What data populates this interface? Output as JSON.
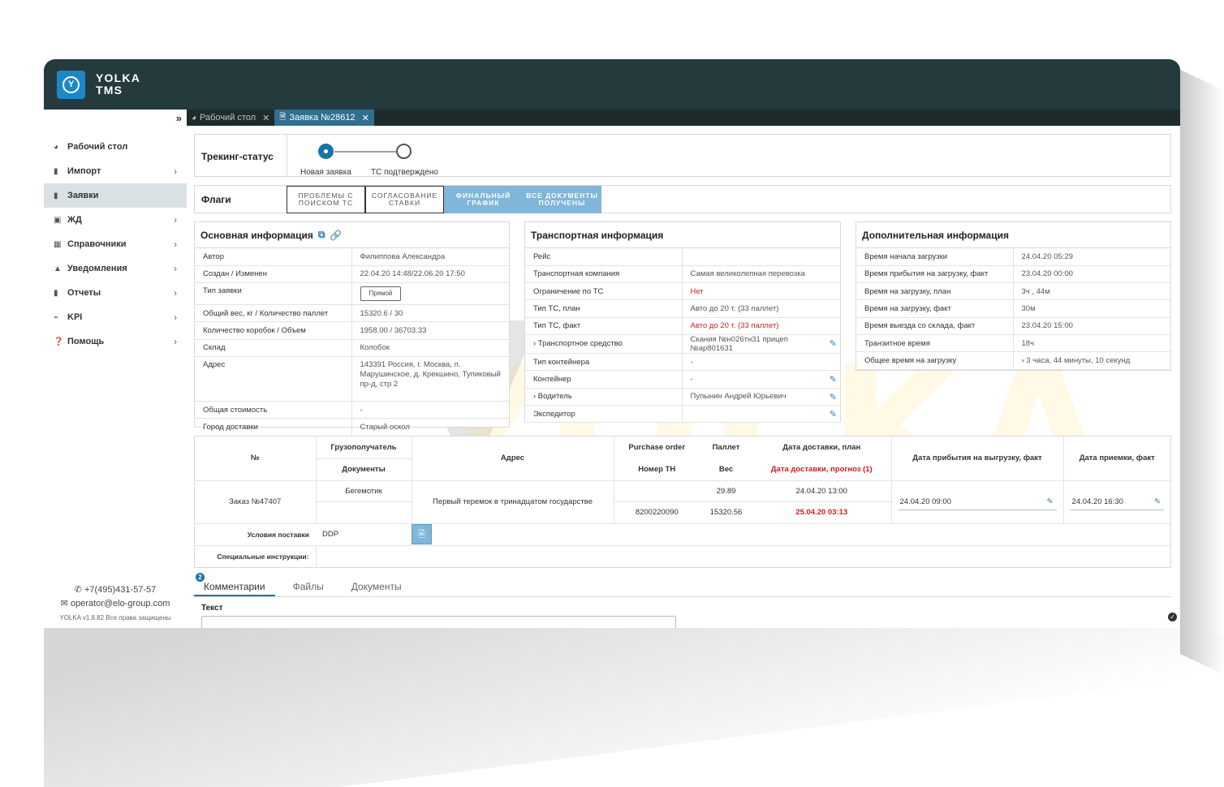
{
  "app": {
    "brand_line1": "YOLKA",
    "brand_line2": "TMS",
    "logo_letter": "Y"
  },
  "tabbar": {
    "collapse_glyph": "»",
    "tabs": [
      {
        "label": "Рабочий стол",
        "icon": "dashboard-icon"
      },
      {
        "label": "Заявка №28612",
        "icon": "document-icon"
      }
    ]
  },
  "sidebar": {
    "items": [
      {
        "label": "Рабочий стол",
        "icon": "dashboard-icon"
      },
      {
        "label": "Импорт",
        "icon": "file-icon"
      },
      {
        "label": "Заявки",
        "icon": "file-icon"
      },
      {
        "label": "ЖД",
        "icon": "train-icon"
      },
      {
        "label": "Справочники",
        "icon": "book-icon"
      },
      {
        "label": "Уведомления",
        "icon": "bell-icon"
      },
      {
        "label": "Отчеты",
        "icon": "file-icon"
      },
      {
        "label": "KPI",
        "icon": "chart-icon"
      },
      {
        "label": "Помощь",
        "icon": "help-icon"
      }
    ],
    "footer": {
      "phone": "+7(495)431-57-57",
      "email": "operator@elo-group.com",
      "copyright": "YOLKA v1.8.82 Все права защищены"
    }
  },
  "tracking": {
    "label": "Трекинг-статус",
    "steps": [
      {
        "label": "Новая заявка",
        "state": "active"
      },
      {
        "label": "ТС подтверждено",
        "state": "pending"
      }
    ]
  },
  "flags": {
    "label": "Флаги",
    "items": [
      {
        "label": "ПРОБЛЕМЫ С ПОИСКОМ ТС",
        "style": "outline"
      },
      {
        "label": "СОГЛАСОВАНИЕ СТАВКИ",
        "style": "outline"
      },
      {
        "label": "ФИНАЛЬНЫЙ ГРАФИК",
        "style": "filled"
      },
      {
        "label": "ВСЕ ДОКУМЕНТЫ ПОЛУЧЕНЫ",
        "style": "filled"
      }
    ]
  },
  "basic_info": {
    "title": "Основная информация",
    "rows": [
      {
        "k": "Автор",
        "v": "Филиппова Александра"
      },
      {
        "k": "Создан / Изменен",
        "v": "22.04.20 14:48/22.06.20 17:50"
      },
      {
        "k": "Тип заявки",
        "v": "Прямой"
      },
      {
        "k": "Общий вес, кг / Количество паллет",
        "v": "15320.6 / 30"
      },
      {
        "k": "Количество коробок / Объем",
        "v": "1958.00 / 36703.33"
      },
      {
        "k": "Склад",
        "v": "Колобок"
      },
      {
        "k": "Адрес",
        "v": "143391 Россия, г. Москва, п. Марушинское, д. Крекшино, Тупиковый пр-д, стр 2"
      },
      {
        "k": "Общая стоимость",
        "v": "-"
      },
      {
        "k": "Город доставки",
        "v": "Старый оскол"
      }
    ]
  },
  "transport_info": {
    "title": "Транспортная информация",
    "rows": [
      {
        "k": "Рейс",
        "v": ""
      },
      {
        "k": "Транспортная компания",
        "v": "Самая великолепная перевозка"
      },
      {
        "k": "Ограничение по ТС",
        "v": "Нет"
      },
      {
        "k": "Тип ТС, план",
        "v": "Авто до 20 т. (33 паллет)"
      },
      {
        "k": "Тип ТС, факт",
        "v": "Авто до 20 т. (33 паллет)"
      },
      {
        "k": "Транспортное средство",
        "v": "Скания №н026тн31 прицеп №ар801631"
      },
      {
        "k": "Тип контейнера",
        "v": "-"
      },
      {
        "k": "Контейнер",
        "v": "-"
      },
      {
        "k": "Водитель",
        "v": "Пупынин Андрей Юрьевич"
      },
      {
        "k": "Экспедитор",
        "v": ""
      }
    ]
  },
  "extra_info": {
    "title": "Дополнительная информация",
    "rows": [
      {
        "k": "Время начала загрузки",
        "v": "24.04.20 05:29"
      },
      {
        "k": "Время прибытия на загрузку, факт",
        "v": "23.04.20 00:00"
      },
      {
        "k": "Время на загрузку, план",
        "v": "3ч , 44м"
      },
      {
        "k": "Время на загрузку, факт",
        "v": "30м"
      },
      {
        "k": "Время выезда со склада, факт",
        "v": "23.04.20 15:00"
      },
      {
        "k": "Транзитное время",
        "v": "18ч"
      },
      {
        "k": "Общее время на загрузку",
        "v": "3 часа, 44 минуты, 10 секунд"
      }
    ]
  },
  "orders": {
    "headers": {
      "num": "№",
      "consignee": "Грузополучатель",
      "documents": "Документы",
      "address": "Адрес",
      "purchase_order": "Purchase order",
      "tn_number": "Номер ТН",
      "pallets": "Паллет",
      "weight": "Вес",
      "delivery_plan": "Дата доставки, план",
      "delivery_forecast": "Дата доставки, прогноз (1)",
      "arrival_fact": "Дата прибытия на выгрузку, факт",
      "acceptance_fact": "Дата приемки, факт"
    },
    "row": {
      "num": "Заказ №47407",
      "consignee": "Бегемотик",
      "documents": "",
      "address": "Первый теремок в тринадцатом государстве",
      "purchase_order": "",
      "tn_number": "8200220090",
      "pallets": "29.89",
      "weight": "15320.56",
      "delivery_plan": "24.04.20 13:00",
      "delivery_forecast": "25.04.20 03:13",
      "arrival_fact": "24.04.20 09:00",
      "acceptance_fact": "24.04.20 16:30"
    },
    "terms_label": "Условия поставки",
    "terms_value": "DDP",
    "instructions_label": "Специальные инструкции:",
    "instructions_value": ""
  },
  "lower_tabs": {
    "items": [
      "Комментарии",
      "Файлы",
      "Документы"
    ],
    "badge": "2",
    "text_label": "Текст"
  },
  "watermark": "YOLKA",
  "colors": {
    "topbar": "#243a3d",
    "accent": "#1a73a8",
    "flag_filled": "#7fb6d9",
    "alert": "#d31c1c"
  }
}
